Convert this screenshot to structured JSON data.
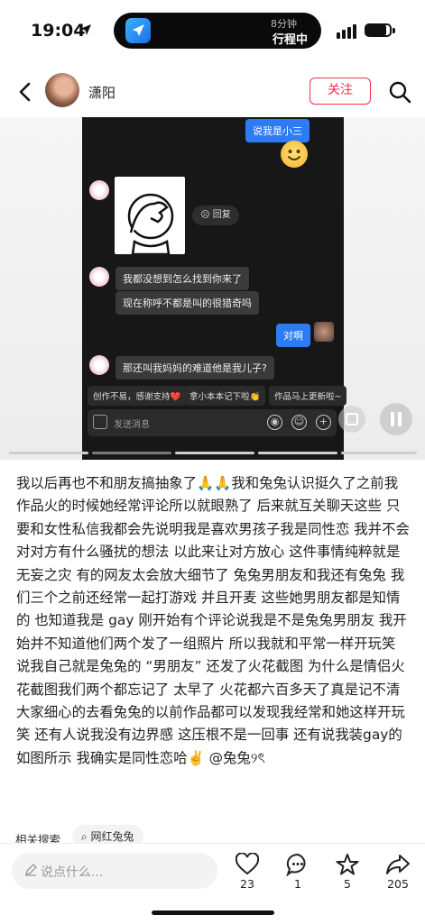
{
  "status_bar": {
    "time": "19:04",
    "island_minutes": "8分钟",
    "island_label": "行程中"
  },
  "header": {
    "author_name": "潇阳",
    "follow_label": "关注"
  },
  "media": {
    "chat": {
      "msg_shuo": "说我是小三",
      "reply_label": "回复",
      "msg_1": "我都没想到怎么找到你来了",
      "msg_2": "现在称呼不都是叫的很猎奇吗",
      "msg_dui": "对啊",
      "msg_3": "那还叫我妈妈的难道他是我儿子?",
      "chips": [
        "创作不易，感谢支持❤️",
        "拿小本本记下啦👏",
        "作品马上更新啦~"
      ],
      "input_placeholder": "发送消息"
    }
  },
  "post": {
    "text": "我以后再也不和朋友搞抽象了🙏🙏我和兔兔认识挺久了之前我作品火的时候她经常评论所以就眼熟了 后来就互关聊天这些 只要和女性私信我都会先说明我是喜欢男孩子我是同性恋 我并不会对对方有什么骚扰的想法 以此来让对方放心  这件事情纯粹就是无妄之灾 有的网友太会放大细节了 兔兔男朋友和我还有兔兔 我们三个之前还经常一起打游戏 并且开麦 这些她男朋友都是知情的 也知道我是 gay 刚开始有个评论说我是不是兔兔男朋友 我开始并不知道他们两个发了一组照片 所以我就和平常一样开玩笑 说我自己就是兔兔的 “男朋友” 还发了火花截图 为什么是情侣火花截图我们两个都忘记了 太早了 火花都六百多天了真是记不清大家细心的去看兔兔的以前作品都可以发现我经常和她这样开玩笑 还有人说我没有边界感 这压根不是一回事 还有说我装gay的 如图所示 我确实是同性恋哈✌️ @兔兔୨ৎ"
  },
  "related": {
    "label": "相关搜索",
    "chip": "网红兔兔"
  },
  "bottom_bar": {
    "comment_placeholder": "说点什么...",
    "like_count": "23",
    "comment_count": "1",
    "star_count": "5",
    "share_count": "205"
  }
}
